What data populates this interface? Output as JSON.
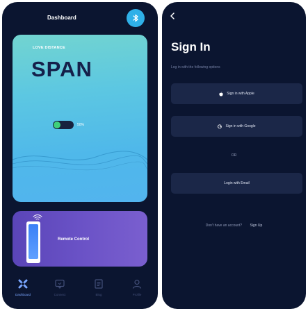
{
  "dashboard": {
    "title": "Dashboard",
    "bluetooth_icon": "bluetooth-icon",
    "love_card": {
      "label": "LOVE DISTANCE",
      "name": "SPAN",
      "toggle_percent_label": "50%",
      "toggle_value": 0.5,
      "toggle_on_color": "#3fd07a"
    },
    "remote_card": {
      "label": "Remote Control",
      "icon": "wifi-icon"
    },
    "tabs": [
      {
        "label": "Dashboard",
        "icon": "dashboard-icon",
        "active": true
      },
      {
        "label": "Connect",
        "icon": "chat-icon",
        "active": false
      },
      {
        "label": "Blog",
        "icon": "document-icon",
        "active": false
      },
      {
        "label": "Profile",
        "icon": "user-icon",
        "active": false
      }
    ]
  },
  "signin": {
    "title": "Sign In",
    "subtitle": "Log in with the following options",
    "apple_label": "Sign in with Apple",
    "google_label": "Sign in with Google",
    "or_label": "OR",
    "email_label": "Login with Email",
    "no_account_text": "Don't have an account?",
    "signup_label": "Sign Up"
  },
  "colors": {
    "background": "#0b1530",
    "accent_blue": "#2fb0e8",
    "card_teal": "#5cc7e2",
    "card_purple": "#6a52c6",
    "button_bg": "#1b2748"
  }
}
